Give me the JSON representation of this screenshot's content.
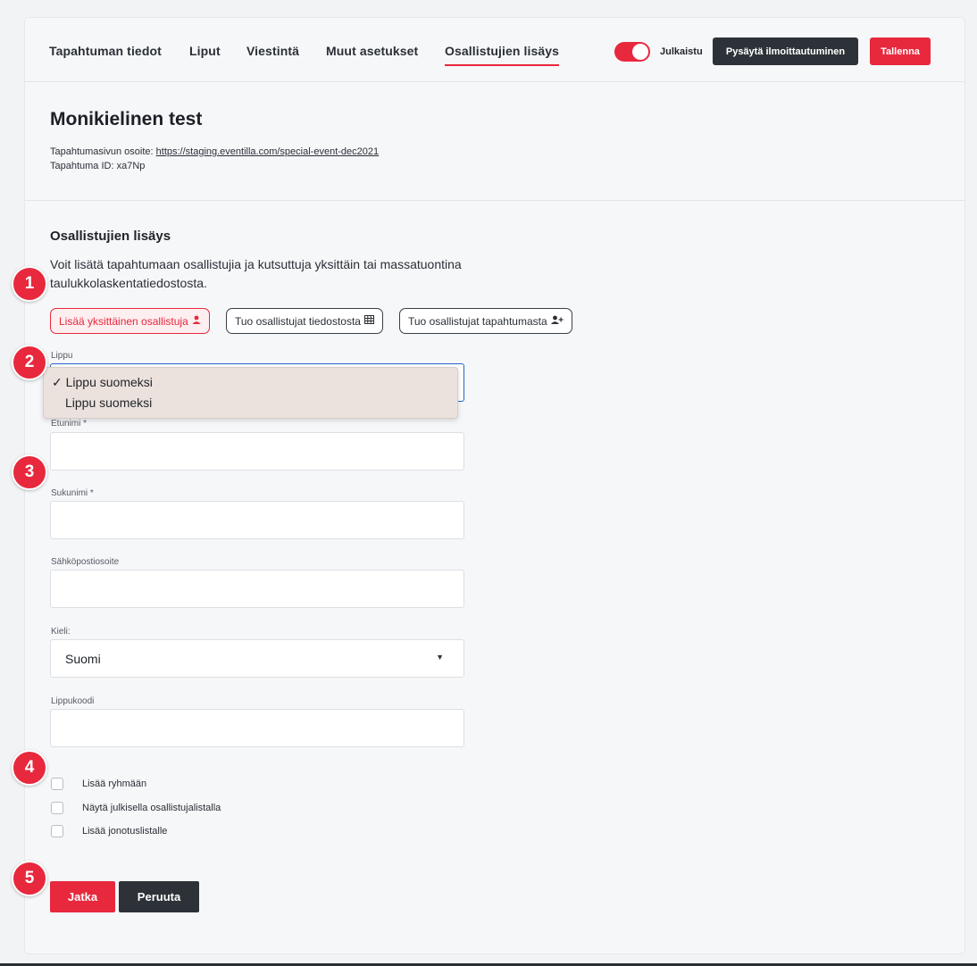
{
  "nav": {
    "tabs": [
      {
        "label": "Tapahtuman tiedot"
      },
      {
        "label": "Liput"
      },
      {
        "label": "Viestintä"
      },
      {
        "label": "Muut asetukset"
      },
      {
        "label": "Osallistujien lisäys",
        "active": true
      }
    ],
    "publish_toggle": {
      "on": true,
      "label": "Julkaistu"
    },
    "stop_registration_label": "Pysäytä ilmoittautuminen",
    "save_label": "Tallenna"
  },
  "event": {
    "title": "Monikielinen test",
    "page_address_label": "Tapahtumasivun osoite:",
    "page_address_url": "https://staging.eventilla.com/special-event-dec2021",
    "id_label": "Tapahtuma ID: xa7Np"
  },
  "section": {
    "title": "Osallistujien lisäys",
    "description": "Voit lisätä tapahtumaan osallistujia ja kutsuttuja yksittäin tai massatuontina taulukkolaskentatiedostosta."
  },
  "modes": [
    {
      "label": "Lisää yksittäinen osallistuja",
      "icon": "user-icon",
      "selected": true
    },
    {
      "label": "Tuo osallistujat tiedostosta",
      "icon": "table-icon"
    },
    {
      "label": "Tuo osallistujat tapahtumasta",
      "icon": "user-plus-icon"
    }
  ],
  "form": {
    "ticket_label": "Lippu",
    "ticket_options": [
      "✓ Lippu suomeksi",
      "Lippu suomeksi"
    ],
    "firstname_label": "Etunimi *",
    "lastname_label": "Sukunimi *",
    "email_label": "Sähköpostiosoite",
    "language_label": "Kieli:",
    "language_value": "Suomi",
    "ticketcode_label": "Lippukoodi",
    "checkboxes": [
      "Lisää ryhmään",
      "Näytä julkisella osallistujalistalla",
      "Lisää jonotuslistalle"
    ],
    "continue_label": "Jatka",
    "cancel_label": "Peruuta"
  },
  "badges": [
    "1",
    "2",
    "3",
    "4",
    "5"
  ],
  "colors": {
    "accent": "#e8283d",
    "dark": "#2d3238"
  }
}
